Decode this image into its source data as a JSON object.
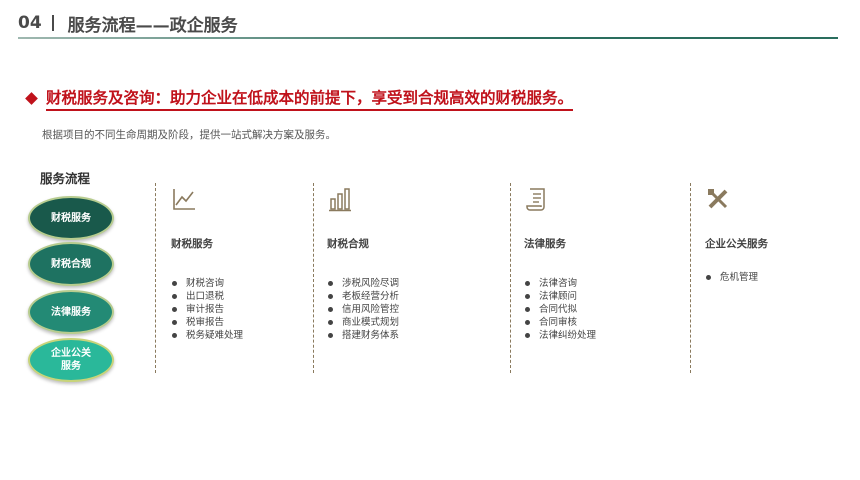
{
  "header": {
    "section_number": "04",
    "title": "服务流程——政企服务"
  },
  "headline": "财税服务及咨询：助力企业在低成本的前提下，享受到合规高效的财税服务。",
  "subtitle": "根据项目的不同生命周期及阶段，提供一站式解决方案及服务。",
  "flow": {
    "label": "服务流程",
    "steps": [
      {
        "label": "财税服务"
      },
      {
        "label": "财税合规"
      },
      {
        "label": "法律服务"
      },
      {
        "label": "企业公关\n服务"
      }
    ]
  },
  "columns": [
    {
      "icon": "line-chart-icon",
      "title": "财税服务",
      "items": [
        "财税咨询",
        "出口退税",
        "审计报告",
        "税审报告",
        "税务疑难处理"
      ]
    },
    {
      "icon": "bar-chart-icon",
      "title": "财税合规",
      "items": [
        "涉税风险尽调",
        "老板经营分析",
        "信用风险管控",
        "商业模式规划",
        "搭建财务体系"
      ]
    },
    {
      "icon": "document-scroll-icon",
      "title": "法律服务",
      "items": [
        "法律咨询",
        "法律顾问",
        "合同代拟",
        "合同审核",
        "法律纠纷处理"
      ]
    },
    {
      "icon": "tools-icon",
      "title": "企业公关服务",
      "items": [
        "危机管理"
      ]
    }
  ],
  "colors": {
    "accent_red": "#c0121b",
    "accent_green": "#19594b",
    "icon_brown": "#8a7a5e"
  }
}
